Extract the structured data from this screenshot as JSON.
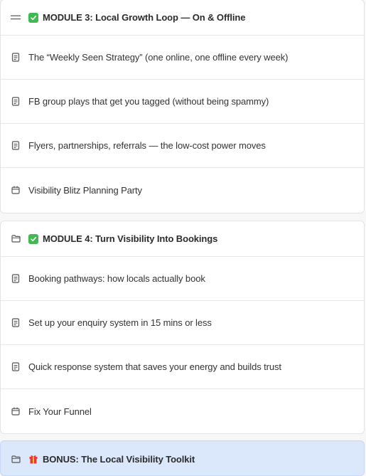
{
  "modules": [
    {
      "title": "MODULE 3: Local Growth Loop — On & Offline",
      "lessons": [
        {
          "icon": "document-icon",
          "label": "The “Weekly Seen Strategy” (one online, one offline every week)"
        },
        {
          "icon": "document-icon",
          "label": "FB group plays that get you tagged (without being spammy)"
        },
        {
          "icon": "document-icon",
          "label": "Flyers, partnerships, referrals — the low-cost power moves"
        },
        {
          "icon": "calendar-icon",
          "label": "Visibility Blitz Planning Party"
        }
      ]
    },
    {
      "title": "MODULE 4: Turn Visibility Into Bookings",
      "lessons": [
        {
          "icon": "document-icon",
          "label": "Booking pathways: how locals actually book"
        },
        {
          "icon": "document-icon",
          "label": "Set up your enquiry system in 15 mins or less"
        },
        {
          "icon": "document-icon",
          "label": "Quick response system that saves your energy and builds trust"
        },
        {
          "icon": "calendar-icon",
          "label": "Fix Your Funnel"
        }
      ]
    },
    {
      "title": "BONUS: The Local Visibility Toolkit"
    }
  ],
  "colors": {
    "check_badge": "#3fb950",
    "active_row": "#dbe8fb"
  }
}
